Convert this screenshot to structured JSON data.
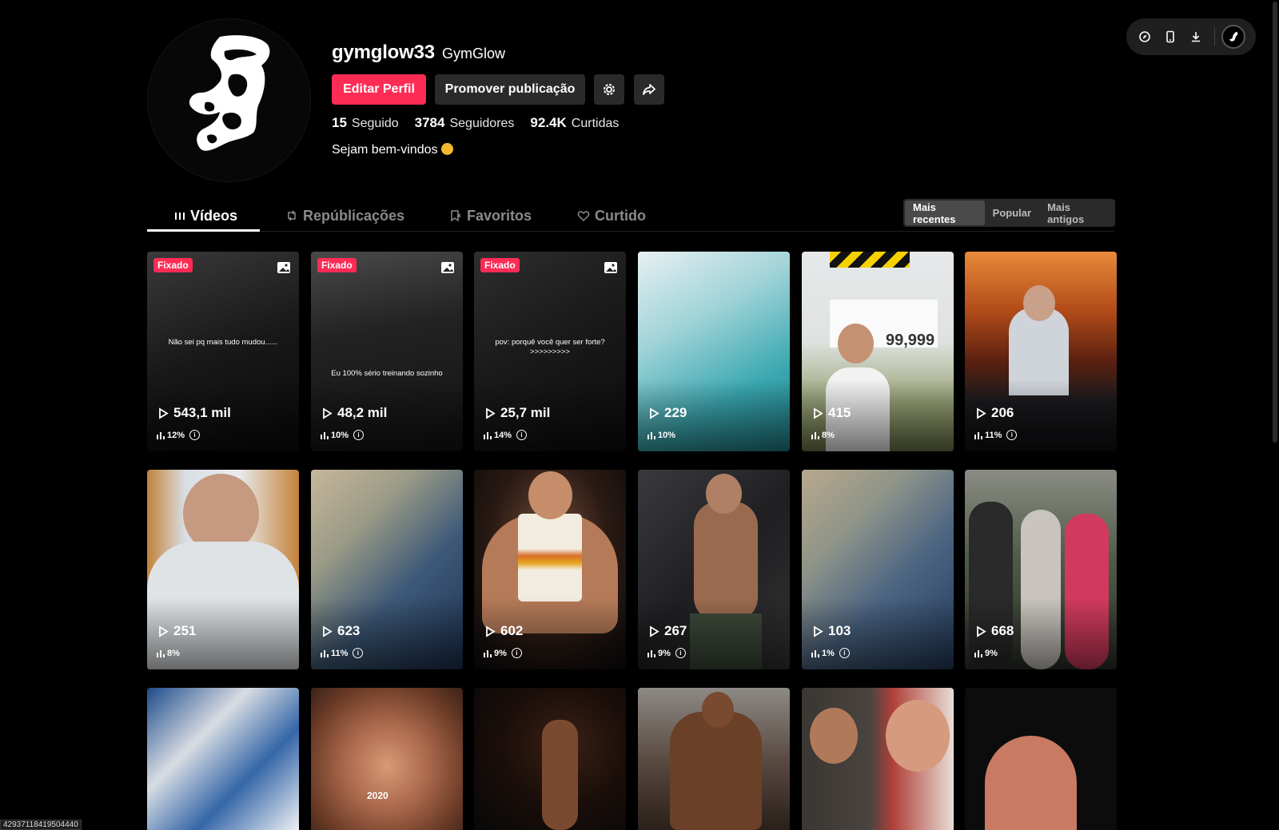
{
  "profile": {
    "username": "gymglow33",
    "nickname": "GymGlow",
    "edit_label": "Editar Perfil",
    "promote_label": "Promover publicação",
    "stats": [
      {
        "value": "15",
        "label": "Seguido"
      },
      {
        "value": "3784",
        "label": "Seguidores"
      },
      {
        "value": "92.4K",
        "label": "Curtidas"
      }
    ],
    "bio": "Sejam bem-vindos"
  },
  "tabs": [
    {
      "label": "Vídeos",
      "icon": "grid-icon"
    },
    {
      "label": "Repúblicações",
      "icon": "repost-icon"
    },
    {
      "label": "Favoritos",
      "icon": "bookmark-icon"
    },
    {
      "label": "Curtido",
      "icon": "heart-icon"
    }
  ],
  "sort": [
    "Mais recentes",
    "Popular",
    "Mais antigos"
  ],
  "videos": [
    {
      "pinned": "Fixado",
      "views": "543,1 mil",
      "rate": "12%",
      "caption": "Não sei pq mais tudo mudou......"
    },
    {
      "pinned": "Fixado",
      "views": "48,2 mil",
      "rate": "10%",
      "caption": "Eu 100% sério treinando sozinho"
    },
    {
      "pinned": "Fixado",
      "views": "25,7 mil",
      "rate": "14%",
      "caption": "pov: porquê você quer ser forte? >>>>>>>>>"
    },
    {
      "views": "229",
      "rate": "10%"
    },
    {
      "views": "415",
      "rate": "8%",
      "sign": "99,999"
    },
    {
      "views": "206",
      "rate": "11%"
    },
    {
      "views": "251",
      "rate": "8%"
    },
    {
      "views": "623",
      "rate": "11%"
    },
    {
      "views": "602",
      "rate": "9%"
    },
    {
      "views": "267",
      "rate": "9%"
    },
    {
      "views": "103",
      "rate": "1%"
    },
    {
      "views": "668",
      "rate": "9%"
    },
    {},
    {
      "year": "2020"
    },
    {},
    {},
    {},
    {}
  ],
  "status_url": "42937118419504440",
  "colors": {
    "accent": "#fe2c55",
    "bg": "#000000",
    "button": "#2a2a2a"
  }
}
